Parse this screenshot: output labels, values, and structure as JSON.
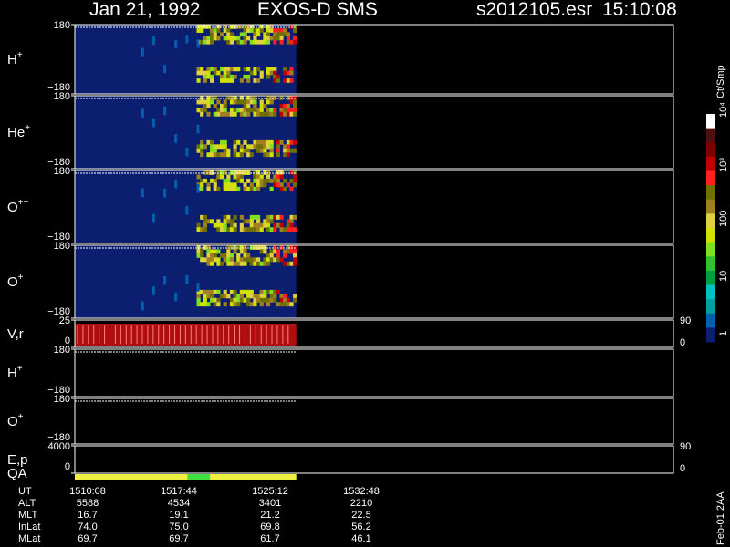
{
  "header": {
    "date": "Jan 21, 1992",
    "instrument": "EXOS-D SMS",
    "file": "s2012105.esr",
    "time": "15:10:08"
  },
  "colorbar": {
    "unit": "Ct/Smp",
    "labels": [
      "1",
      "10",
      "100",
      "10³",
      "10⁴"
    ],
    "colors": [
      "#0a1f6e",
      "#0060b0",
      "#00a0a0",
      "#00c0c0",
      "#00a040",
      "#30c030",
      "#80e020",
      "#d0e000",
      "#e0d040",
      "#a08020",
      "#707000",
      "#ff2020",
      "#c00000",
      "#800000",
      "#501010",
      "#ffffff"
    ]
  },
  "footer": {
    "note": "Feb-01  2AA",
    "rows": [
      {
        "label": "UT",
        "values": [
          "1510:08",
          "1517:44",
          "1525:12",
          "1532:48"
        ]
      },
      {
        "label": "ALT",
        "values": [
          "5588",
          "4534",
          "3401",
          "2210"
        ]
      },
      {
        "label": "MLT",
        "values": [
          "16.7",
          "19.1",
          "21.2",
          "22.5"
        ]
      },
      {
        "label": "InLat",
        "values": [
          "74.0",
          "75.0",
          "69.8",
          "56.2"
        ]
      },
      {
        "label": "MLat",
        "values": [
          "69.7",
          "69.7",
          "61.7",
          "46.1"
        ]
      }
    ]
  },
  "chart_data": {
    "type": "heatmap",
    "x_ticks": [
      "1510:08",
      "1517:44",
      "1525:12",
      "1532:48"
    ],
    "panels": [
      {
        "key": "h",
        "label": "H",
        "sup": "+",
        "ticks": [
          "180",
          "−180"
        ],
        "right_ticks": []
      },
      {
        "key": "he",
        "label": "He",
        "sup": "+",
        "ticks": [
          "180",
          "−180"
        ],
        "right_ticks": []
      },
      {
        "key": "o2",
        "label": "O",
        "sup": "++",
        "ticks": [
          "180",
          "−180"
        ],
        "right_ticks": []
      },
      {
        "key": "o1",
        "label": "O",
        "sup": "+",
        "ticks": [
          "180",
          "−180"
        ],
        "right_ticks": []
      },
      {
        "key": "vr",
        "label": "V,r",
        "sup": "",
        "ticks": [
          "25",
          "0"
        ],
        "right_ticks": [
          "90",
          "0"
        ]
      },
      {
        "key": "h2",
        "label": "H",
        "sup": "+",
        "ticks": [
          "180",
          "−180"
        ],
        "right_ticks": []
      },
      {
        "key": "o3",
        "label": "O",
        "sup": "+",
        "ticks": [
          "180",
          "−180"
        ],
        "right_ticks": []
      },
      {
        "key": "ep",
        "label": "E,p",
        "sup": "",
        "ticks": [
          "4000",
          "0"
        ],
        "right_ticks": [
          "90",
          "0"
        ]
      },
      {
        "key": "qa",
        "label": "QA",
        "sup": "",
        "ticks": [],
        "right_ticks": []
      }
    ],
    "qa_segments": [
      {
        "from": 0.0,
        "to": 0.51,
        "color": "#f0f040"
      },
      {
        "from": 0.51,
        "to": 0.61,
        "color": "#40e040"
      },
      {
        "from": 0.61,
        "to": 1.0,
        "color": "#f0f040"
      }
    ],
    "data_coverage_fraction": 0.37
  }
}
